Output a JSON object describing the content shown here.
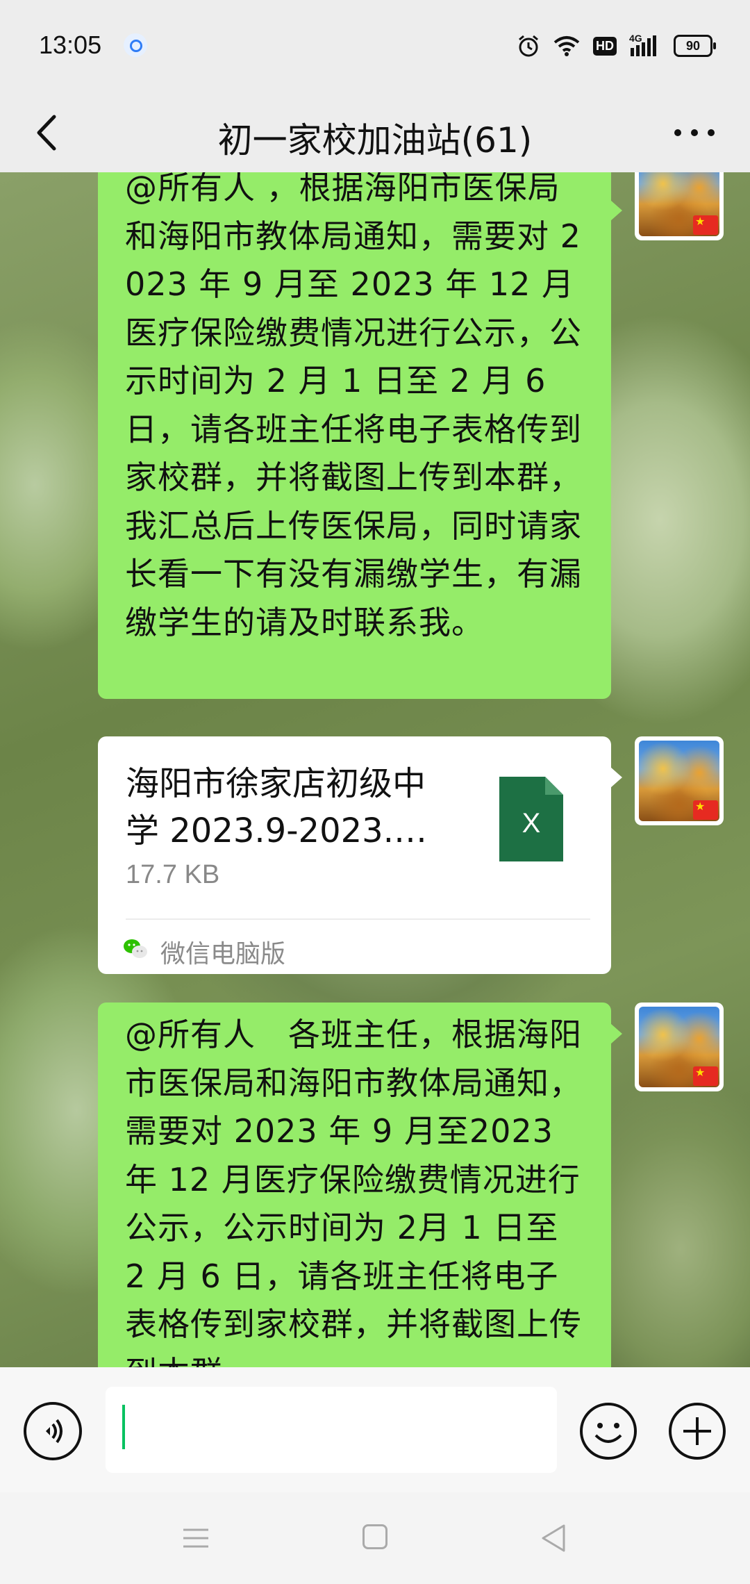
{
  "status_bar": {
    "time": "13:05",
    "signal": "4G",
    "hd": "HD",
    "battery": "90"
  },
  "header": {
    "title": "初一家校加油站(61)"
  },
  "messages": [
    {
      "type": "text",
      "text": "@所有人 ，根据海阳市医保局和海阳市教体局通知，需要对 2023 年 9 月至 2023 年 12 月医疗保险缴费情况进行公示，公示时间为 2 月 1 日至 2 月 6 日，请各班主任将电子表格传到家校群，并将截图上传到本群，我汇总后上传医保局，同时请家长看一下有没有漏缴学生，有漏缴学生的请及时联系我。"
    },
    {
      "type": "file",
      "file_name": "海阳市徐家店初级中学 2023.9-2023.…",
      "file_size": "17.7 KB",
      "file_icon": "X",
      "source": "微信电脑版"
    },
    {
      "type": "text",
      "text": "@所有人　各班主任，根据海阳市医保局和海阳市教体局通知，需要对 2023 年 9 月至2023 年 12 月医疗保险缴费情况进行公示，公示时间为 2月 1 日至 2 月 6 日，请各班主任将电子表格传到家校群，并将截图上传到本群"
    }
  ],
  "colors": {
    "bubble_green": "#95ec69",
    "wechat_green": "#07c160",
    "excel_green": "#1d7044"
  }
}
